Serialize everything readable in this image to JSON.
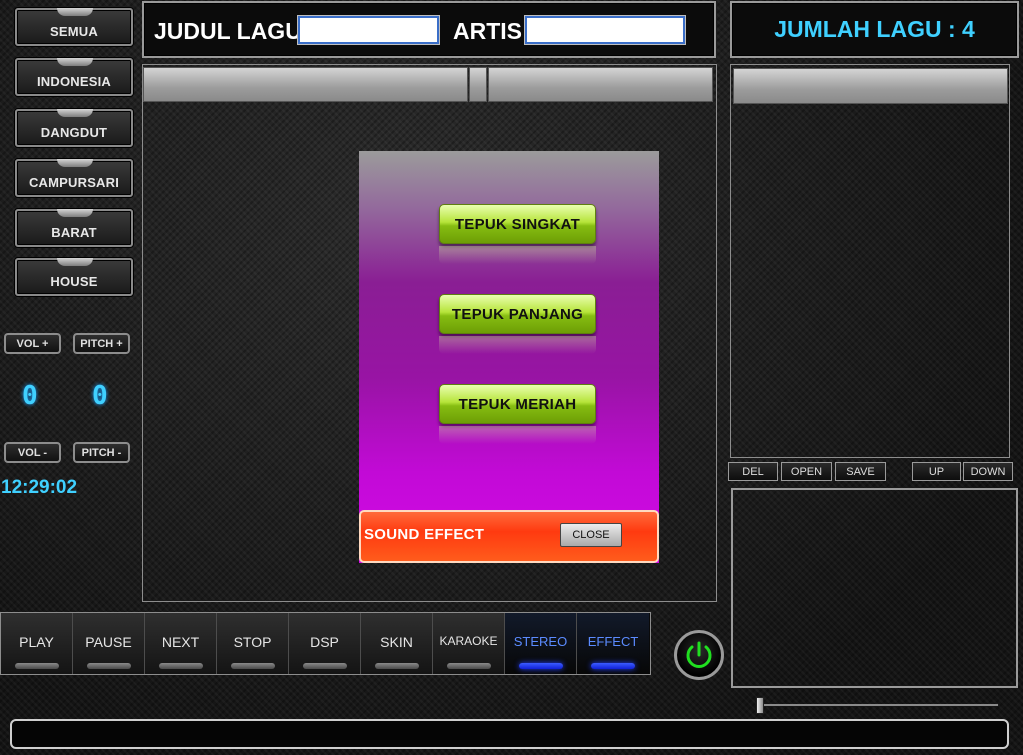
{
  "categories": [
    "SEMUA",
    "INDONESIA",
    "DANGDUT",
    "CAMPURSARI",
    "BARAT",
    "HOUSE"
  ],
  "controls": {
    "vol_plus": "VOL +",
    "pitch_plus": "PITCH +",
    "vol_minus": "VOL -",
    "pitch_minus": "PITCH -",
    "vol_value": "0",
    "pitch_value": "0",
    "clock": "12:29:02"
  },
  "header": {
    "title_label": "JUDUL LAGU",
    "title_value": "",
    "artist_label": "ARTIS",
    "artist_value": "",
    "song_count": "JUMLAH LAGU : 4"
  },
  "popup": {
    "buttons": [
      "TEPUK SINGKAT",
      "TEPUK PANJANG",
      "TEPUK MERIAH"
    ],
    "footer_title": "SOUND EFFECT",
    "close_label": "CLOSE"
  },
  "playlist_buttons": {
    "del": "DEL",
    "open": "OPEN",
    "save": "SAVE",
    "up": "UP",
    "down": "DOWN"
  },
  "transport": [
    {
      "label": "PLAY",
      "active": false
    },
    {
      "label": "PAUSE",
      "active": false
    },
    {
      "label": "NEXT",
      "active": false
    },
    {
      "label": "STOP",
      "active": false
    },
    {
      "label": "DSP",
      "active": false
    },
    {
      "label": "SKIN",
      "active": false
    },
    {
      "label": "KARAOKE",
      "active": false
    },
    {
      "label": "STEREO",
      "active": true
    },
    {
      "label": "EFFECT",
      "active": true
    }
  ],
  "status_text": "",
  "colors": {
    "accent_cyan": "#3fd0ff",
    "active_blue": "#2440ff",
    "power_green": "#20e020",
    "effect_green": "#b6e43a",
    "popup_magenta": "#c20ad6",
    "footer_orange": "#ff3a10"
  },
  "icons": {
    "power": "power-icon",
    "slider": "volume-slider-thumb"
  }
}
